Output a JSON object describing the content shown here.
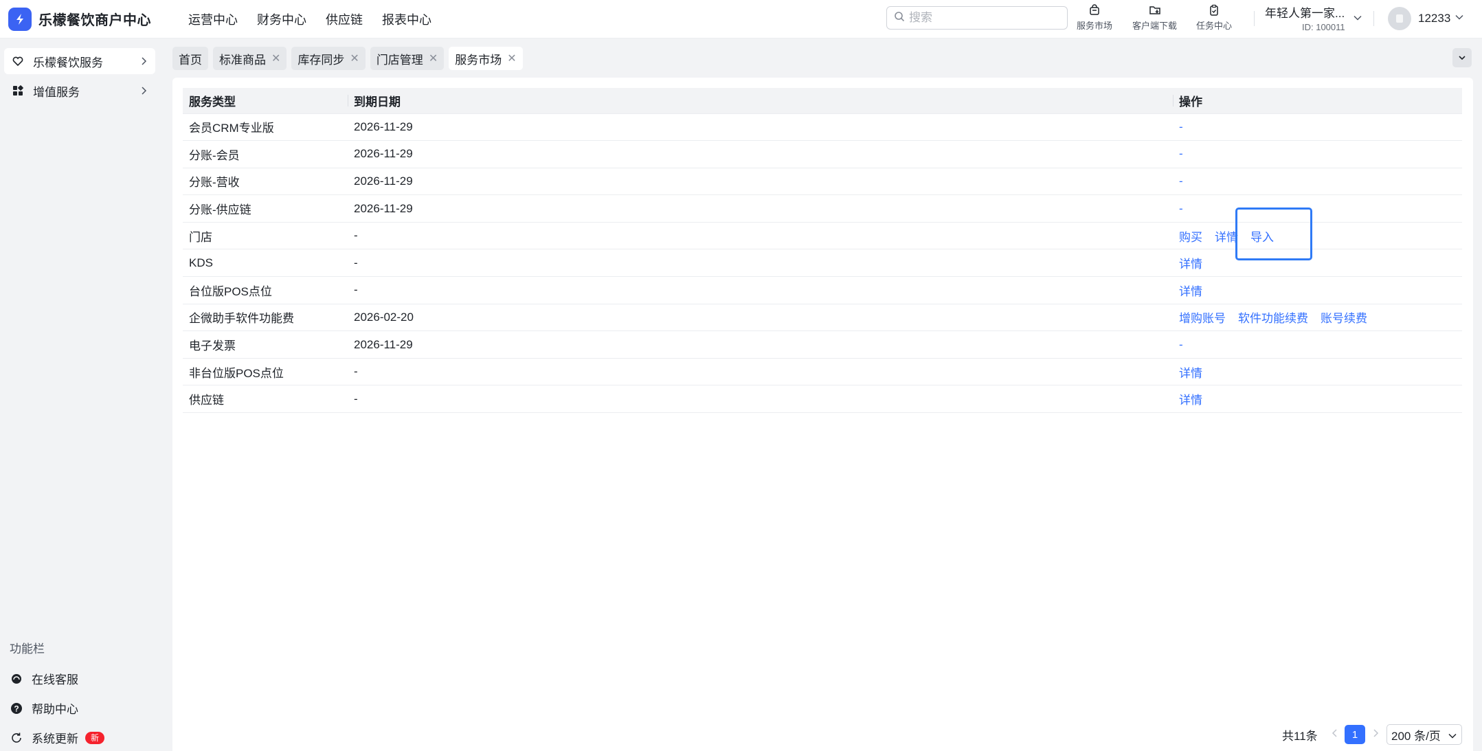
{
  "app": {
    "title": "乐檬餐饮商户中心"
  },
  "nav": {
    "items": [
      "运营中心",
      "财务中心",
      "供应链",
      "报表中心"
    ]
  },
  "search": {
    "placeholder": "搜索"
  },
  "tools": {
    "market": "服务市场",
    "download": "客户端下载",
    "tasks": "任务中心"
  },
  "store": {
    "name": "年轻人第一家...",
    "id": "ID: 100011"
  },
  "user": {
    "name": "12233"
  },
  "sidebar": {
    "items": [
      {
        "label": "乐檬餐饮服务"
      },
      {
        "label": "增值服务"
      }
    ],
    "func_title": "功能栏",
    "func_items": [
      {
        "label": "在线客服"
      },
      {
        "label": "帮助中心"
      },
      {
        "label": "系统更新",
        "badge": "新"
      }
    ]
  },
  "tabs": [
    {
      "label": "首页"
    },
    {
      "label": "标准商品"
    },
    {
      "label": "库存同步"
    },
    {
      "label": "门店管理"
    },
    {
      "label": "服务市场"
    }
  ],
  "table": {
    "headers": [
      "服务类型",
      "到期日期",
      "操作"
    ],
    "rows": [
      {
        "type": "会员CRM专业版",
        "date": "2026-11-29",
        "actions": [],
        "dash": "-"
      },
      {
        "type": "分账-会员",
        "date": "2026-11-29",
        "actions": [],
        "dash": "-"
      },
      {
        "type": "分账-营收",
        "date": "2026-11-29",
        "actions": [],
        "dash": "-"
      },
      {
        "type": "分账-供应链",
        "date": "2026-11-29",
        "actions": [],
        "dash": "-"
      },
      {
        "type": "门店",
        "date": "-",
        "actions": [
          "购买",
          "详情",
          "导入"
        ]
      },
      {
        "type": "KDS",
        "date": "-",
        "actions": [
          "详情"
        ]
      },
      {
        "type": "台位版POS点位",
        "date": "-",
        "actions": [
          "详情"
        ]
      },
      {
        "type": "企微助手软件功能费",
        "date": "2026-02-20",
        "actions": [
          "增购账号",
          "软件功能续费",
          "账号续费"
        ]
      },
      {
        "type": "电子发票",
        "date": "2026-11-29",
        "actions": [],
        "dash": "-"
      },
      {
        "type": "非台位版POS点位",
        "date": "-",
        "actions": [
          "详情"
        ]
      },
      {
        "type": "供应链",
        "date": "-",
        "actions": [
          "详情"
        ]
      }
    ]
  },
  "pagination": {
    "total": "共11条",
    "current": "1",
    "page_size": "200 条/页"
  },
  "colors": {
    "accent": "#3370ff",
    "brand": "#3b63f3",
    "highlight": "#2f7af6",
    "badge": "#f5222d"
  }
}
